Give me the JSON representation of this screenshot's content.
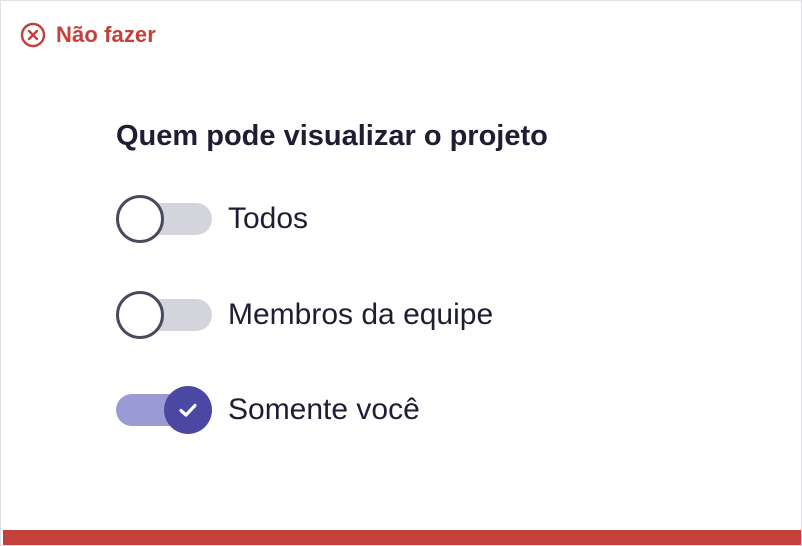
{
  "header": {
    "icon": "close-circle-icon",
    "label": "Não fazer",
    "color": "#c4403b"
  },
  "title": "Quem pode visualizar o projeto",
  "options": [
    {
      "label": "Todos",
      "checked": false
    },
    {
      "label": "Membros da equipe",
      "checked": false
    },
    {
      "label": "Somente você",
      "checked": true
    }
  ],
  "colors": {
    "accent": "#4b48a3",
    "track_on": "#9a9ad4",
    "track_off": "#d4d4dc",
    "danger": "#c4403b",
    "text": "#1e1d33"
  }
}
